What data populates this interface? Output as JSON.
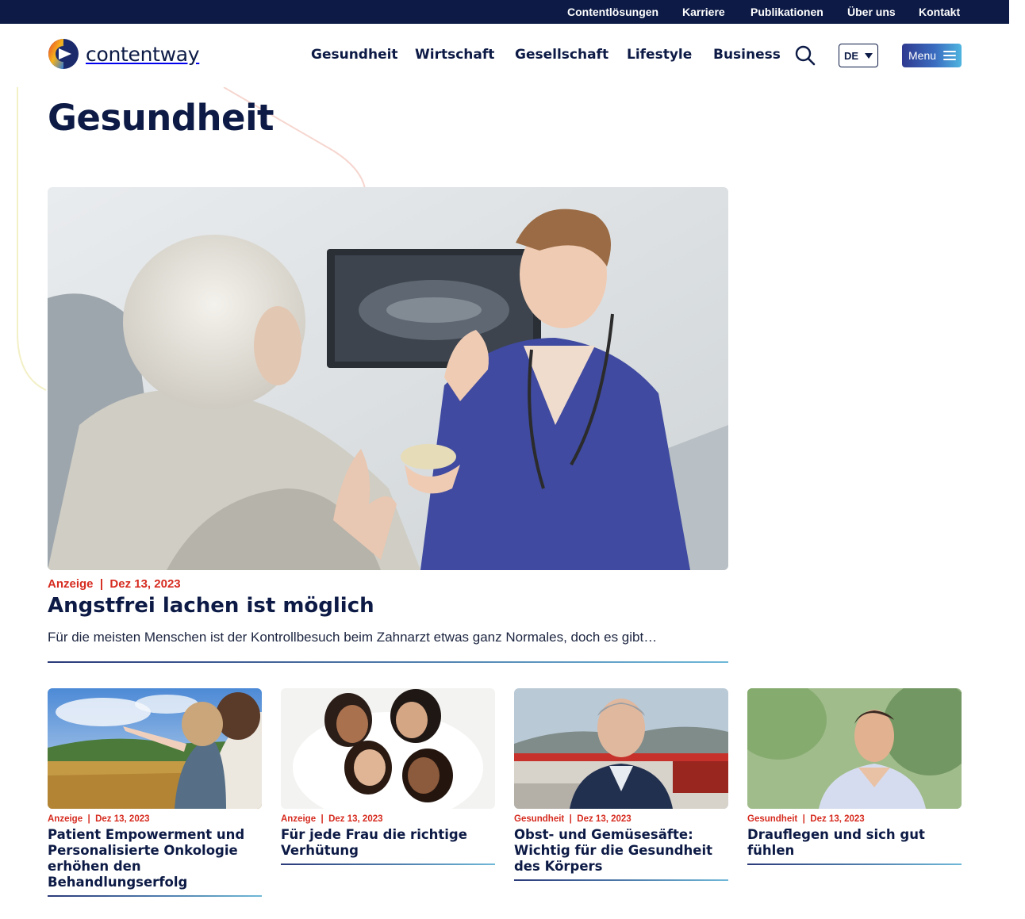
{
  "topbar": {
    "links": [
      "Contentlösungen",
      "Karriere",
      "Publikationen",
      "Über uns",
      "Kontakt"
    ]
  },
  "header": {
    "logo_text": "contentway",
    "nav": [
      "Gesundheit",
      "Wirtschaft",
      "Gesellschaft",
      "Lifestyle",
      "Business"
    ],
    "search_icon": "search-icon",
    "language": "DE",
    "menu_label": "Menu"
  },
  "page": {
    "title": "Gesundheit"
  },
  "featured": {
    "category": "Anzeige",
    "date": "Dez 13, 2023",
    "title": "Angstfrei lachen ist möglich",
    "excerpt": "Für die meisten Menschen ist der Kontrollbesuch beim Zahnarzt etwas ganz Normales, doch es gibt…"
  },
  "articles": [
    {
      "category": "Anzeige",
      "date": "Dez 13, 2023",
      "title": "Patient Empowerment und Personalisierte Onkologie erhöhen den Behandlungserfolg"
    },
    {
      "category": "Anzeige",
      "date": "Dez 13, 2023",
      "title": "Für jede Frau die richtige Verhütung"
    },
    {
      "category": "Gesundheit",
      "date": "Dez 13, 2023",
      "title": "Obst- und Gemüsesäfte: Wichtig für die Gesundheit des Körpers"
    },
    {
      "category": "Gesundheit",
      "date": "Dez 13, 2023",
      "title": "Drauflegen und sich gut fühlen"
    }
  ],
  "colors": {
    "navy": "#0c1a45",
    "accent_red": "#d62b1f",
    "menu_gradient_start": "#2f3a8f",
    "menu_gradient_end": "#4fb5e0"
  }
}
